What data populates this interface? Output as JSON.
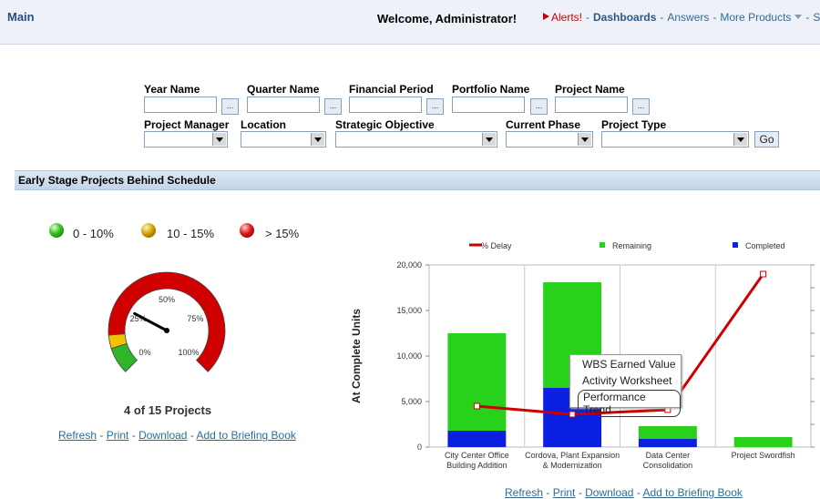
{
  "header": {
    "title": "Main",
    "welcome": "Welcome, Administrator!",
    "alerts": "Alerts!",
    "dashboards": "Dashboards",
    "answers": "Answers",
    "more_products": "More Products",
    "cut_item": "S",
    "sep": "-"
  },
  "prompts": {
    "year_name": "Year Name",
    "quarter_name": "Quarter Name",
    "financial_period": "Financial Period",
    "portfolio_name": "Portfolio Name",
    "project_name": "Project Name",
    "project_manager": "Project Manager",
    "location": "Location",
    "strategic_objective": "Strategic Objective",
    "current_phase": "Current Phase",
    "project_type": "Project Type",
    "browse_label": "...",
    "go": "Go"
  },
  "section": {
    "title": "Early Stage Projects Behind Schedule"
  },
  "gauge": {
    "legend": [
      "0 - 10%",
      "10 - 15%",
      "> 15%"
    ],
    "tick_labels": [
      "0%",
      "25%",
      "50%",
      "75%",
      "100%"
    ],
    "needle_value_percent": 27,
    "caption": "4 of 15 Projects",
    "colors": {
      "green": "#2fb52a",
      "yellow": "#f2c200",
      "red": "#d10000"
    }
  },
  "links_left": {
    "refresh": "Refresh",
    "print": "Print",
    "download": "Download",
    "briefing": "Add to Briefing Book",
    "sep": "-"
  },
  "links_right": {
    "refresh": "Refresh",
    "print": "Print",
    "download": "Download",
    "briefing": "Add to Briefing Book",
    "sep": "-"
  },
  "chart_data": {
    "type": "bar",
    "stacked": true,
    "categories": [
      [
        "City Center Office",
        "Building Addition"
      ],
      [
        "Cordova, Plant Expansion",
        "& Modernization"
      ],
      [
        "Data Center",
        "Consolidation"
      ],
      [
        "Project Swordfish"
      ]
    ],
    "series": [
      {
        "name": "Completed",
        "color": "#0a1fe0",
        "values": [
          1800,
          6500,
          900,
          0
        ]
      },
      {
        "name": "Remaining",
        "color": "#27d11c",
        "values": [
          10700,
          11600,
          1400,
          1100
        ]
      },
      {
        "name": "% Delay",
        "color": "#cc0000",
        "type": "line",
        "axis": "secondary",
        "values": [
          4.5,
          3.6,
          4.1,
          19.0
        ]
      }
    ],
    "ylabel": "At Complete Units",
    "ylim": [
      0,
      20000
    ],
    "yticks": [
      "0",
      "5,000",
      "10,000",
      "15,000",
      "20,000"
    ],
    "y2lim": [
      0,
      20
    ],
    "legend_position": "top",
    "grid": true
  },
  "context_menu": {
    "items": [
      "WBS Earned Value",
      "Activity Worksheet",
      "Performance Trend"
    ]
  }
}
